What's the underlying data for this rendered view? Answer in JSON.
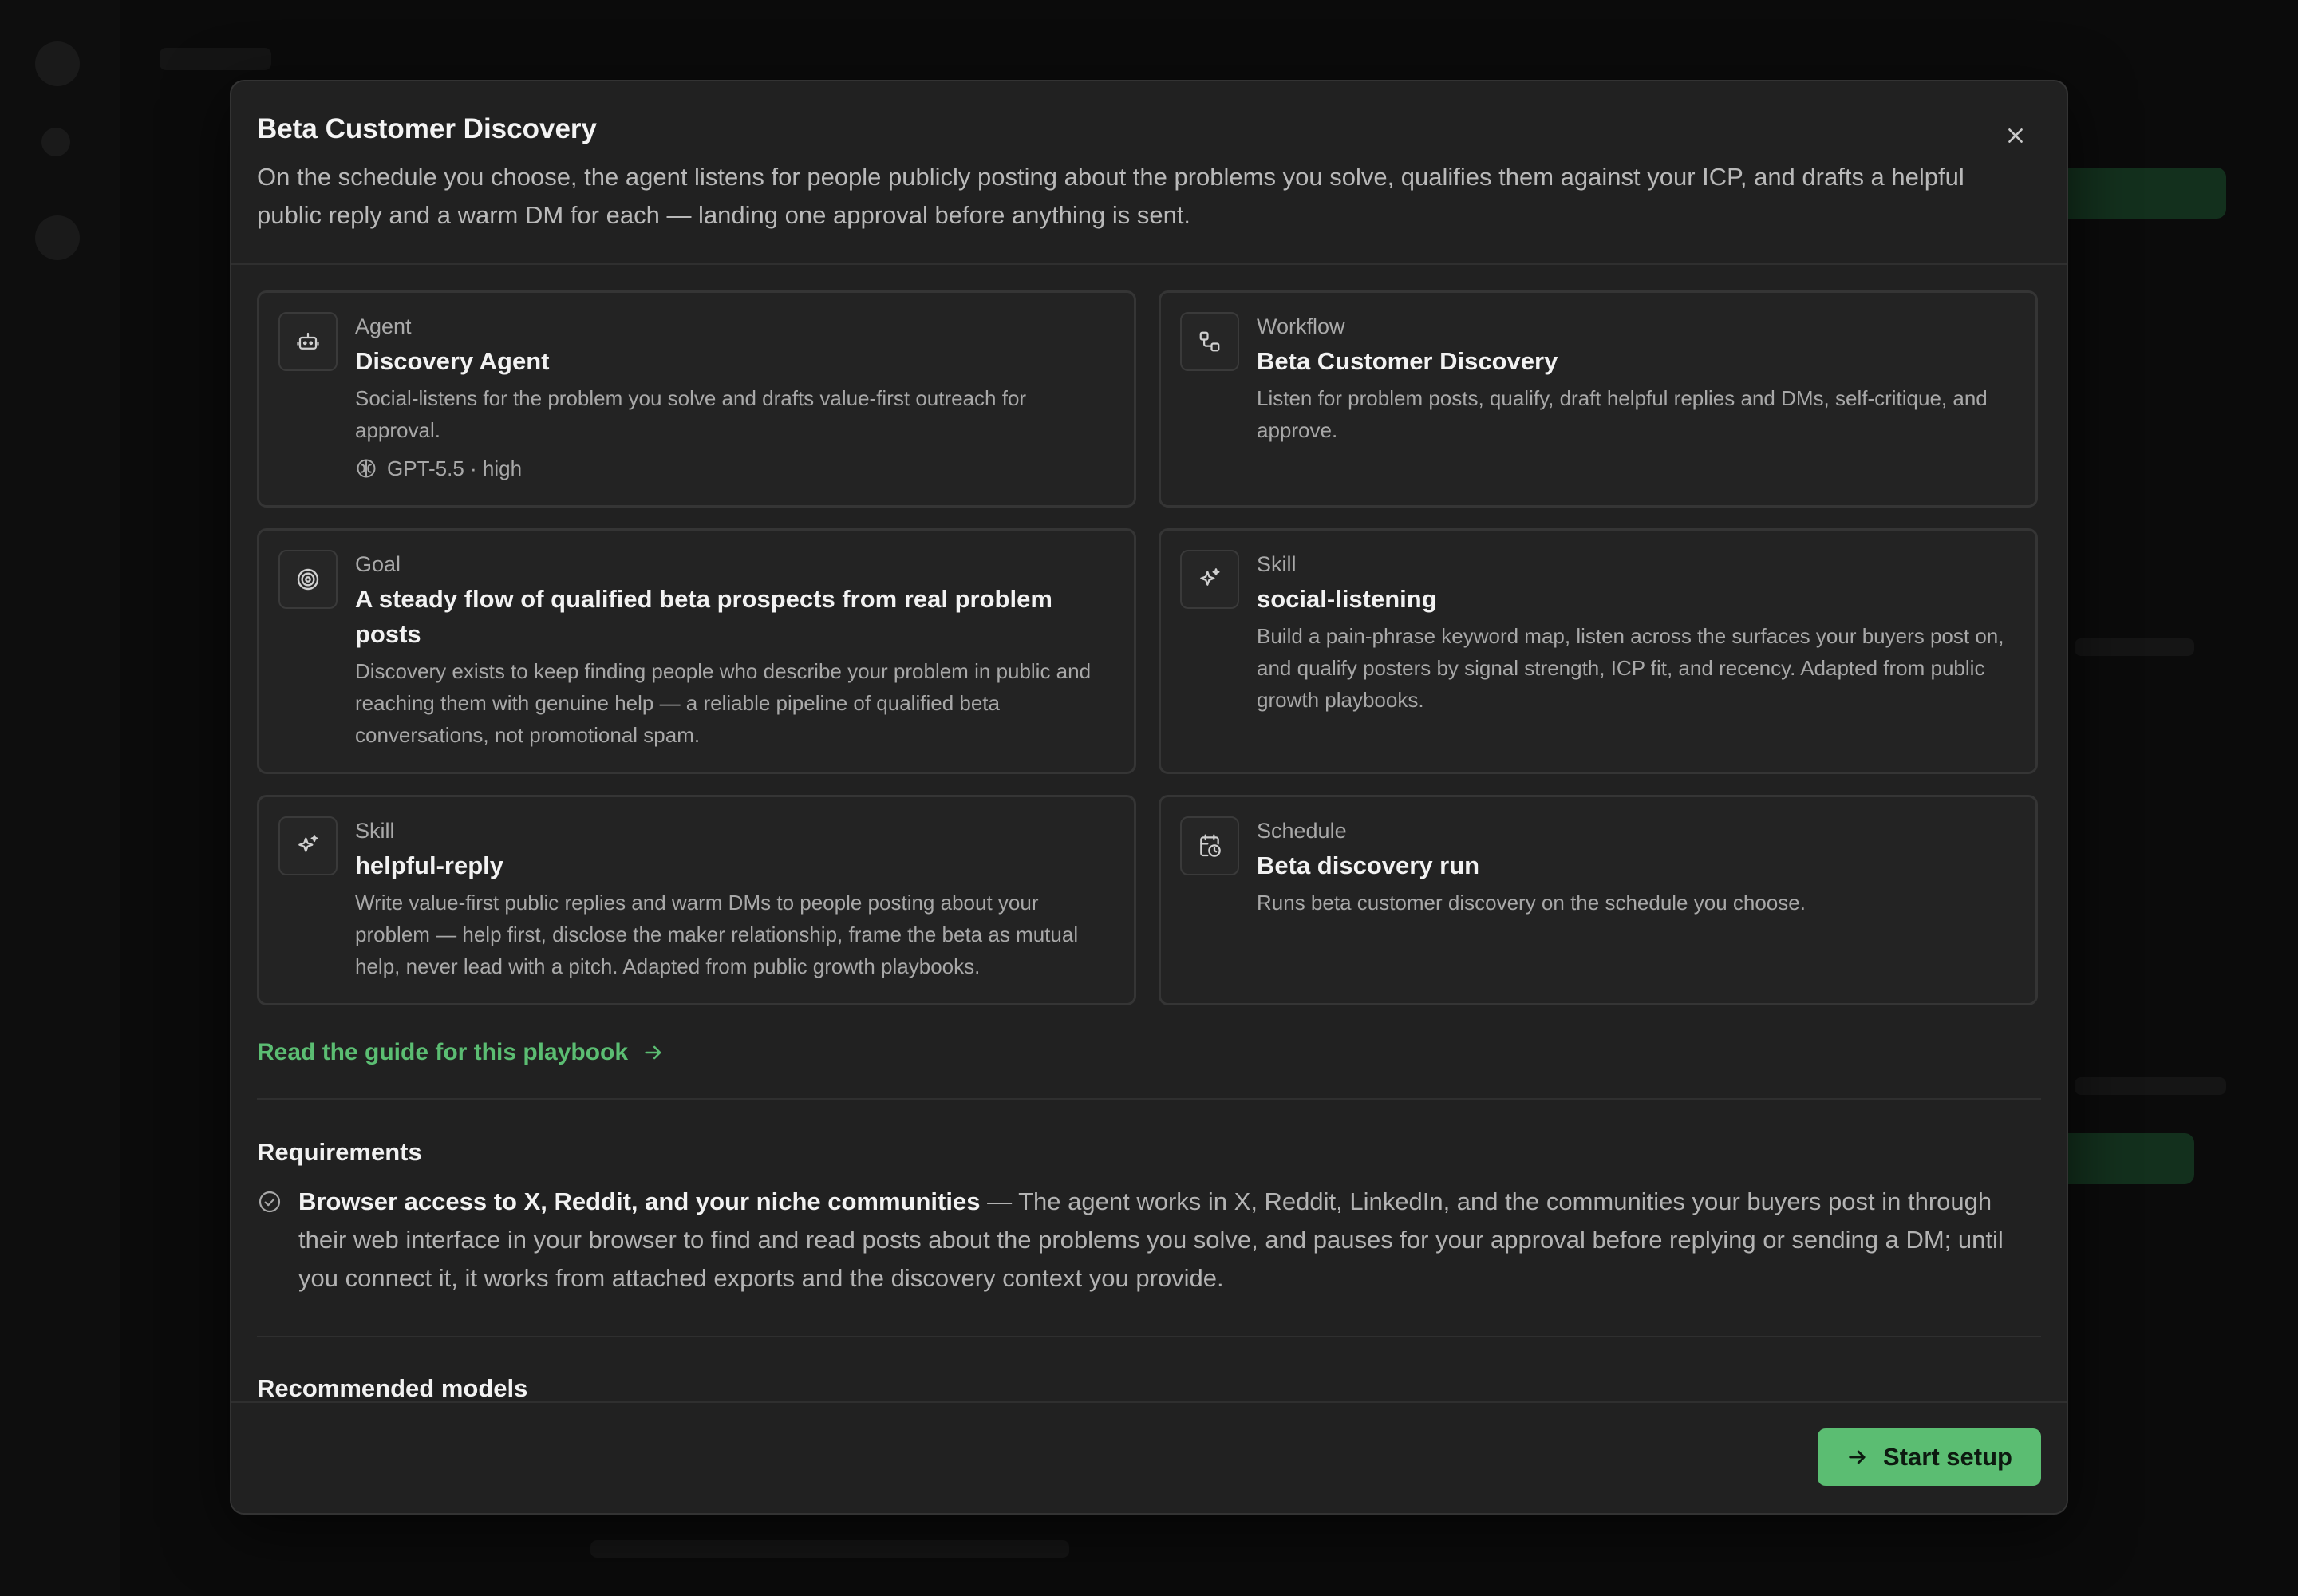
{
  "modal": {
    "title": "Beta Customer Discovery",
    "description": "On the schedule you choose, the agent listens for people publicly posting about the problems you solve, qualifies them against your ICP, and drafts a helpful public reply and a warm DM for each — landing one approval before anything is sent.",
    "close_icon": "close-icon"
  },
  "cards": [
    {
      "icon": "robot-icon",
      "kind": "Agent",
      "name": "Discovery Agent",
      "text": "Social-listens for the problem you solve and drafts value-first outreach for approval.",
      "model": "GPT-5.5 · high"
    },
    {
      "icon": "workflow-icon",
      "kind": "Workflow",
      "name": "Beta Customer Discovery",
      "text": "Listen for problem posts, qualify, draft helpful replies and DMs, self-critique, and approve."
    },
    {
      "icon": "target-icon",
      "kind": "Goal",
      "name": "A steady flow of qualified beta prospects from real problem posts",
      "text": "Discovery exists to keep finding people who describe your problem in public and reaching them with genuine help — a reliable pipeline of qualified beta conversations, not promotional spam."
    },
    {
      "icon": "sparkle-icon",
      "kind": "Skill",
      "name": "social-listening",
      "text": "Build a pain-phrase keyword map, listen across the surfaces your buyers post on, and qualify posters by signal strength, ICP fit, and recency. Adapted from public growth playbooks."
    },
    {
      "icon": "sparkle-icon",
      "kind": "Skill",
      "name": "helpful-reply",
      "text": "Write value-first public replies and warm DMs to people posting about your problem — help first, disclose the maker relationship, frame the beta as mutual help, never lead with a pitch. Adapted from public growth playbooks."
    },
    {
      "icon": "calendar-clock-icon",
      "kind": "Schedule",
      "name": "Beta discovery run",
      "text": "Runs beta customer discovery on the schedule you choose."
    }
  ],
  "guide_link": "Read the guide for this playbook",
  "requirements": {
    "title": "Requirements",
    "item_bold": "Browser access to X, Reddit, and your niche communities",
    "item_text": " — The agent works in X, Reddit, LinkedIn, and the communities your buyers post in through their web interface in your browser to find and read posts about the problems you solve, and pauses for your approval before replying or sending a DM; until you connect it, it works from attached exports and the discovery context you provide."
  },
  "recommended_models_title": "Recommended models",
  "footer": {
    "start_label": "Start setup"
  },
  "colors": {
    "accent": "#5bbd72",
    "modal_bg": "#212121",
    "page_bg": "#0b0b0b"
  }
}
